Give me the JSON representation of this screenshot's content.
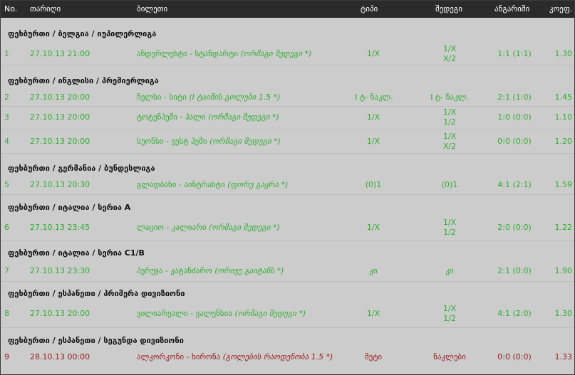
{
  "header": {
    "no": "No.",
    "date": "თარიღი",
    "ticket": "ბილეთი",
    "type": "ტიპი",
    "outcome": "შედეგი",
    "score": "ანგარიში",
    "coef": "კოეფ."
  },
  "groups": [
    "ფეხბურთი / ბელგია / იუპილერლიგა",
    "ფეხბურთი / ინგლისი / პრემიერლიგა",
    "ფეხბურთი / გერმანია / ბუნდესლიგა",
    "ფეხბურთი / იტალია / სერია A",
    "ფეხბურთი / იტალია / სერია C1/B",
    "ფეხბურთი / ესპანეთი / პრიმერა დივიზიონი",
    "ფეხბურთი / ესპანეთი / სეგუნდა დივიზიონი"
  ],
  "rows": [
    {
      "no": "1",
      "date": "27.10.13 21:00",
      "event": "ანდერლეხტი - სტანდარტი",
      "note": "(ორმაგი შედეგი *)",
      "type": "1/X",
      "won1": "1/X",
      "won2": "X/2",
      "score": "1:1 (1:1)",
      "coef": "1.30"
    },
    {
      "no": "2",
      "date": "27.10.13 20:00",
      "event": "ჩელსი - სიტი",
      "note": "(I ტაიმის გოლები 1.5 *)",
      "type": "I ტ- ნაკლ.",
      "won1": "I ტ- ნაკლ.",
      "won2": "",
      "score": "2:1 (1:0)",
      "coef": "1.45"
    },
    {
      "no": "3",
      "date": "27.10.13 20:00",
      "event": "ტოტენჰემი - ჰალი",
      "note": "(ორმაგი შედეგი *)",
      "type": "1/X",
      "won1": "1/X",
      "won2": "1/2",
      "score": "1:0 (0:0)",
      "coef": "1.10"
    },
    {
      "no": "4",
      "date": "27.10.13 20:00",
      "event": "სუონსი - ვესტ ჰემი",
      "note": "(ორმაგი შედეგი *)",
      "type": "1/X",
      "won1": "1/X",
      "won2": "X/2",
      "score": "0:0 (0:0)",
      "coef": "1.20"
    },
    {
      "no": "5",
      "date": "27.10.13 20:30",
      "event": "გლადბახი - აინტრახტი",
      "note": "(ფორუ გაყრა *)",
      "type": "(0)1",
      "won1": "(0)1",
      "won2": "",
      "score": "4:1 (2:1)",
      "coef": "1.59"
    },
    {
      "no": "6",
      "date": "27.10.13 23:45",
      "event": "ლაციო - კალიარი",
      "note": "(ორმაგი შედეგი *)",
      "type": "1/X",
      "won1": "1/X",
      "won2": "1/2",
      "score": "2:0 (0:0)",
      "coef": "1.22"
    },
    {
      "no": "7",
      "date": "27.10.13 23:30",
      "event": "პერუჯა - კატანძარო",
      "note": "(ორივე გაიტანს *)",
      "type": "კი",
      "won1": "კი",
      "won2": "",
      "score": "2:1 (0:0)",
      "coef": "1.90"
    },
    {
      "no": "8",
      "date": "27.10.13 20:00",
      "event": "ვილიარეალი - ვალენსია",
      "note": "(ორმაგი შედეგი *)",
      "type": "1/X",
      "won1": "1/X",
      "won2": "1/2",
      "score": "4:1 (2:0)",
      "coef": "1.30"
    },
    {
      "no": "9",
      "date": "28.10.13 00:00",
      "event": "ალკორკონი - ხირონა",
      "note": "(გოლების რაოდენობა 1.5 *)",
      "type": "მეტი",
      "won1": "ნაკლები",
      "won2": "",
      "score": "0:0 (0:0)",
      "coef": "1.33"
    }
  ],
  "colors": {
    "win": "#2fae2f",
    "loss": "#9b1b1b",
    "header_bg": "#2b2b2b",
    "row_bg": "#cccccc"
  }
}
